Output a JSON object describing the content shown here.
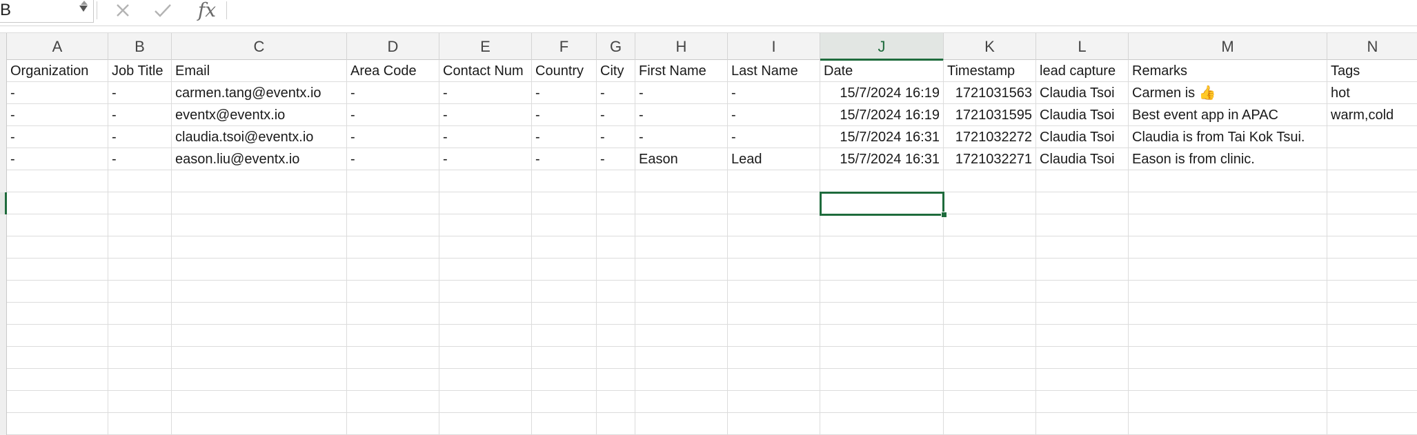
{
  "formula_bar": {
    "name_box_value": "B",
    "cancel_icon": "close-icon",
    "enter_icon": "check-icon",
    "function_label": "fx",
    "formula_value": ""
  },
  "columns": [
    {
      "letter": "A",
      "width": 147
    },
    {
      "letter": "B",
      "width": 92
    },
    {
      "letter": "C",
      "width": 254
    },
    {
      "letter": "D",
      "width": 134
    },
    {
      "letter": "E",
      "width": 134
    },
    {
      "letter": "F",
      "width": 94
    },
    {
      "letter": "G",
      "width": 56
    },
    {
      "letter": "H",
      "width": 134
    },
    {
      "letter": "I",
      "width": 134
    },
    {
      "letter": "J",
      "width": 179
    },
    {
      "letter": "K",
      "width": 134
    },
    {
      "letter": "L",
      "width": 134
    },
    {
      "letter": "M",
      "width": 288
    },
    {
      "letter": "N",
      "width": 132
    }
  ],
  "selected_column": "J",
  "headers": [
    "Organization",
    "Job Title",
    "Email",
    "Area Code",
    "Contact Num",
    "Country",
    "City",
    "First Name",
    "Last Name",
    "Date",
    "Timestamp",
    "lead capture",
    "Remarks",
    "Tags"
  ],
  "rows": [
    [
      "-",
      "-",
      "carmen.tang@eventx.io",
      "-",
      "-",
      "-",
      "-",
      "-",
      "-",
      "15/7/2024 16:19",
      "1721031563",
      "Claudia Tsoi",
      "Carmen is 👍",
      "hot"
    ],
    [
      "-",
      "-",
      "eventx@eventx.io",
      "-",
      "-",
      "-",
      "-",
      "-",
      "-",
      "15/7/2024 16:19",
      "1721031595",
      "Claudia Tsoi",
      "Best event app in APAC",
      "warm,cold"
    ],
    [
      "-",
      "-",
      "claudia.tsoi@eventx.io",
      "-",
      "-",
      "-",
      "-",
      "-",
      "-",
      "15/7/2024 16:31",
      "1721032272",
      "Claudia Tsoi",
      "Claudia is from Tai Kok Tsui.",
      ""
    ],
    [
      "-",
      "-",
      "eason.liu@eventx.io",
      "-",
      "-",
      "-",
      "-",
      "Eason",
      "Lead",
      "15/7/2024 16:31",
      "1721032271",
      "Claudia Tsoi",
      "Eason is from clinic.",
      ""
    ]
  ],
  "numeric_columns": [
    9,
    10
  ],
  "empty_row_count": 12,
  "accent_color": "#1e6b3c"
}
